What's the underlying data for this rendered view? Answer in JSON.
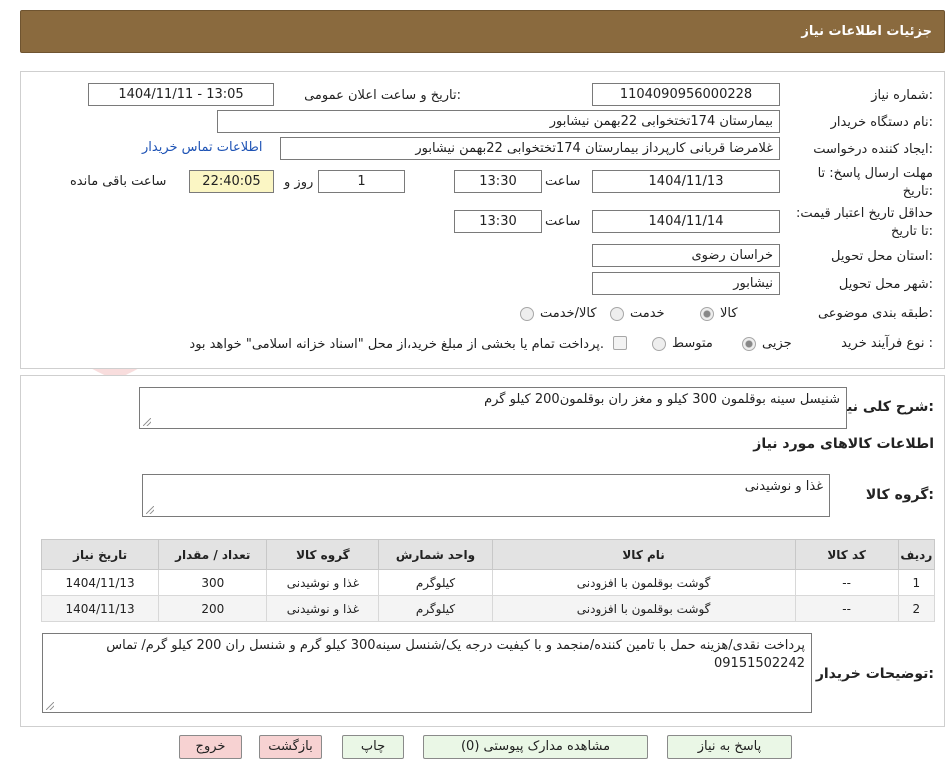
{
  "header": {
    "title": "جزئیات اطلاعات نیاز"
  },
  "info": {
    "need_number_label": "شماره نیاز:",
    "need_number": "1104090956000228",
    "announce_label": "تاریخ و ساعت اعلان عمومی:",
    "announce_value": "1404/11/11 - 13:05",
    "buyer_org_label": "نام دستگاه خریدار:",
    "buyer_org": "بیمارستان 174تختخوابی 22بهمن نیشابور",
    "requester_label": "ایجاد کننده درخواست:",
    "requester": "غلامرضا قربانی کارپرداز بیمارستان 174تختخوابی 22بهمن نیشابور",
    "contact_link": "اطلاعات تماس خریدار",
    "deadline_label": "مهلت ارسال پاسخ: تا تاریخ:",
    "deadline_date": "1404/11/13",
    "time_label": "ساعت",
    "deadline_time": "13:30",
    "days": "1",
    "days_label": "روز و",
    "remaining": "22:40:05",
    "remaining_label": "ساعت باقی مانده",
    "validity_label": "حداقل تاریخ اعتبار قیمت: تا تاریخ:",
    "validity_date": "1404/11/14",
    "validity_time": "13:30",
    "province_label": "استان محل تحویل:",
    "province": "خراسان رضوی",
    "city_label": "شهر محل تحویل:",
    "city": "نیشابور",
    "category_label": "طبقه بندی موضوعی:",
    "category_options": [
      "کالا",
      "خدمت",
      "کالا/خدمت"
    ],
    "process_label": "نوع فرآیند خرید :",
    "process_options": [
      "جزیی",
      "متوسط"
    ],
    "treasury_note": "پرداخت تمام یا بخشی از مبلغ خرید،از محل \"اسناد خزانه اسلامی\" خواهد بود."
  },
  "detail": {
    "summary_label": "شرح کلی نیاز:",
    "summary": "شنیسل سینه بوقلمون 300 کیلو و مغز ران بوقلمون200  کیلو گرم",
    "goods_info_title": "اطلاعات کالاهای مورد نیاز",
    "group_label": "گروه کالا:",
    "group_value": "غذا و نوشیدنی",
    "table_headers": [
      "ردیف",
      "کد کالا",
      "نام کالا",
      "واحد شمارش",
      "گروه کالا",
      "تعداد / مقدار",
      "تاریخ نیاز"
    ],
    "rows": [
      [
        "1",
        "--",
        "گوشت بوقلمون با افزودنی",
        "کیلوگرم",
        "غذا و نوشیدنی",
        "300",
        "1404/11/13"
      ],
      [
        "2",
        "--",
        "گوشت بوقلمون با افزودنی",
        "کیلوگرم",
        "غذا و نوشیدنی",
        "200",
        "1404/11/13"
      ]
    ],
    "buyer_notes_label": "توضیحات خریدار:",
    "buyer_notes": "پرداخت نقدی/هزینه حمل با تامین کننده/منجمد و با کیفیت درجه یک/شنسل سینه300 کیلو گرم و شنسل ران 200 کیلو گرم/ تماس 09151502242"
  },
  "buttons": {
    "reply": "پاسخ به نیاز",
    "attachments": "مشاهده مدارک پیوستی (0)",
    "print": "چاپ",
    "back": "بازگشت",
    "exit": "خروج"
  },
  "watermark_text": "AriaTender.neT",
  "colors": {
    "header": "#8a6a3e",
    "link": "#1e53b5",
    "remaining_bg": "#fbf6c4",
    "button": "#eaf7e6",
    "button_red": "#f7d2d2"
  }
}
